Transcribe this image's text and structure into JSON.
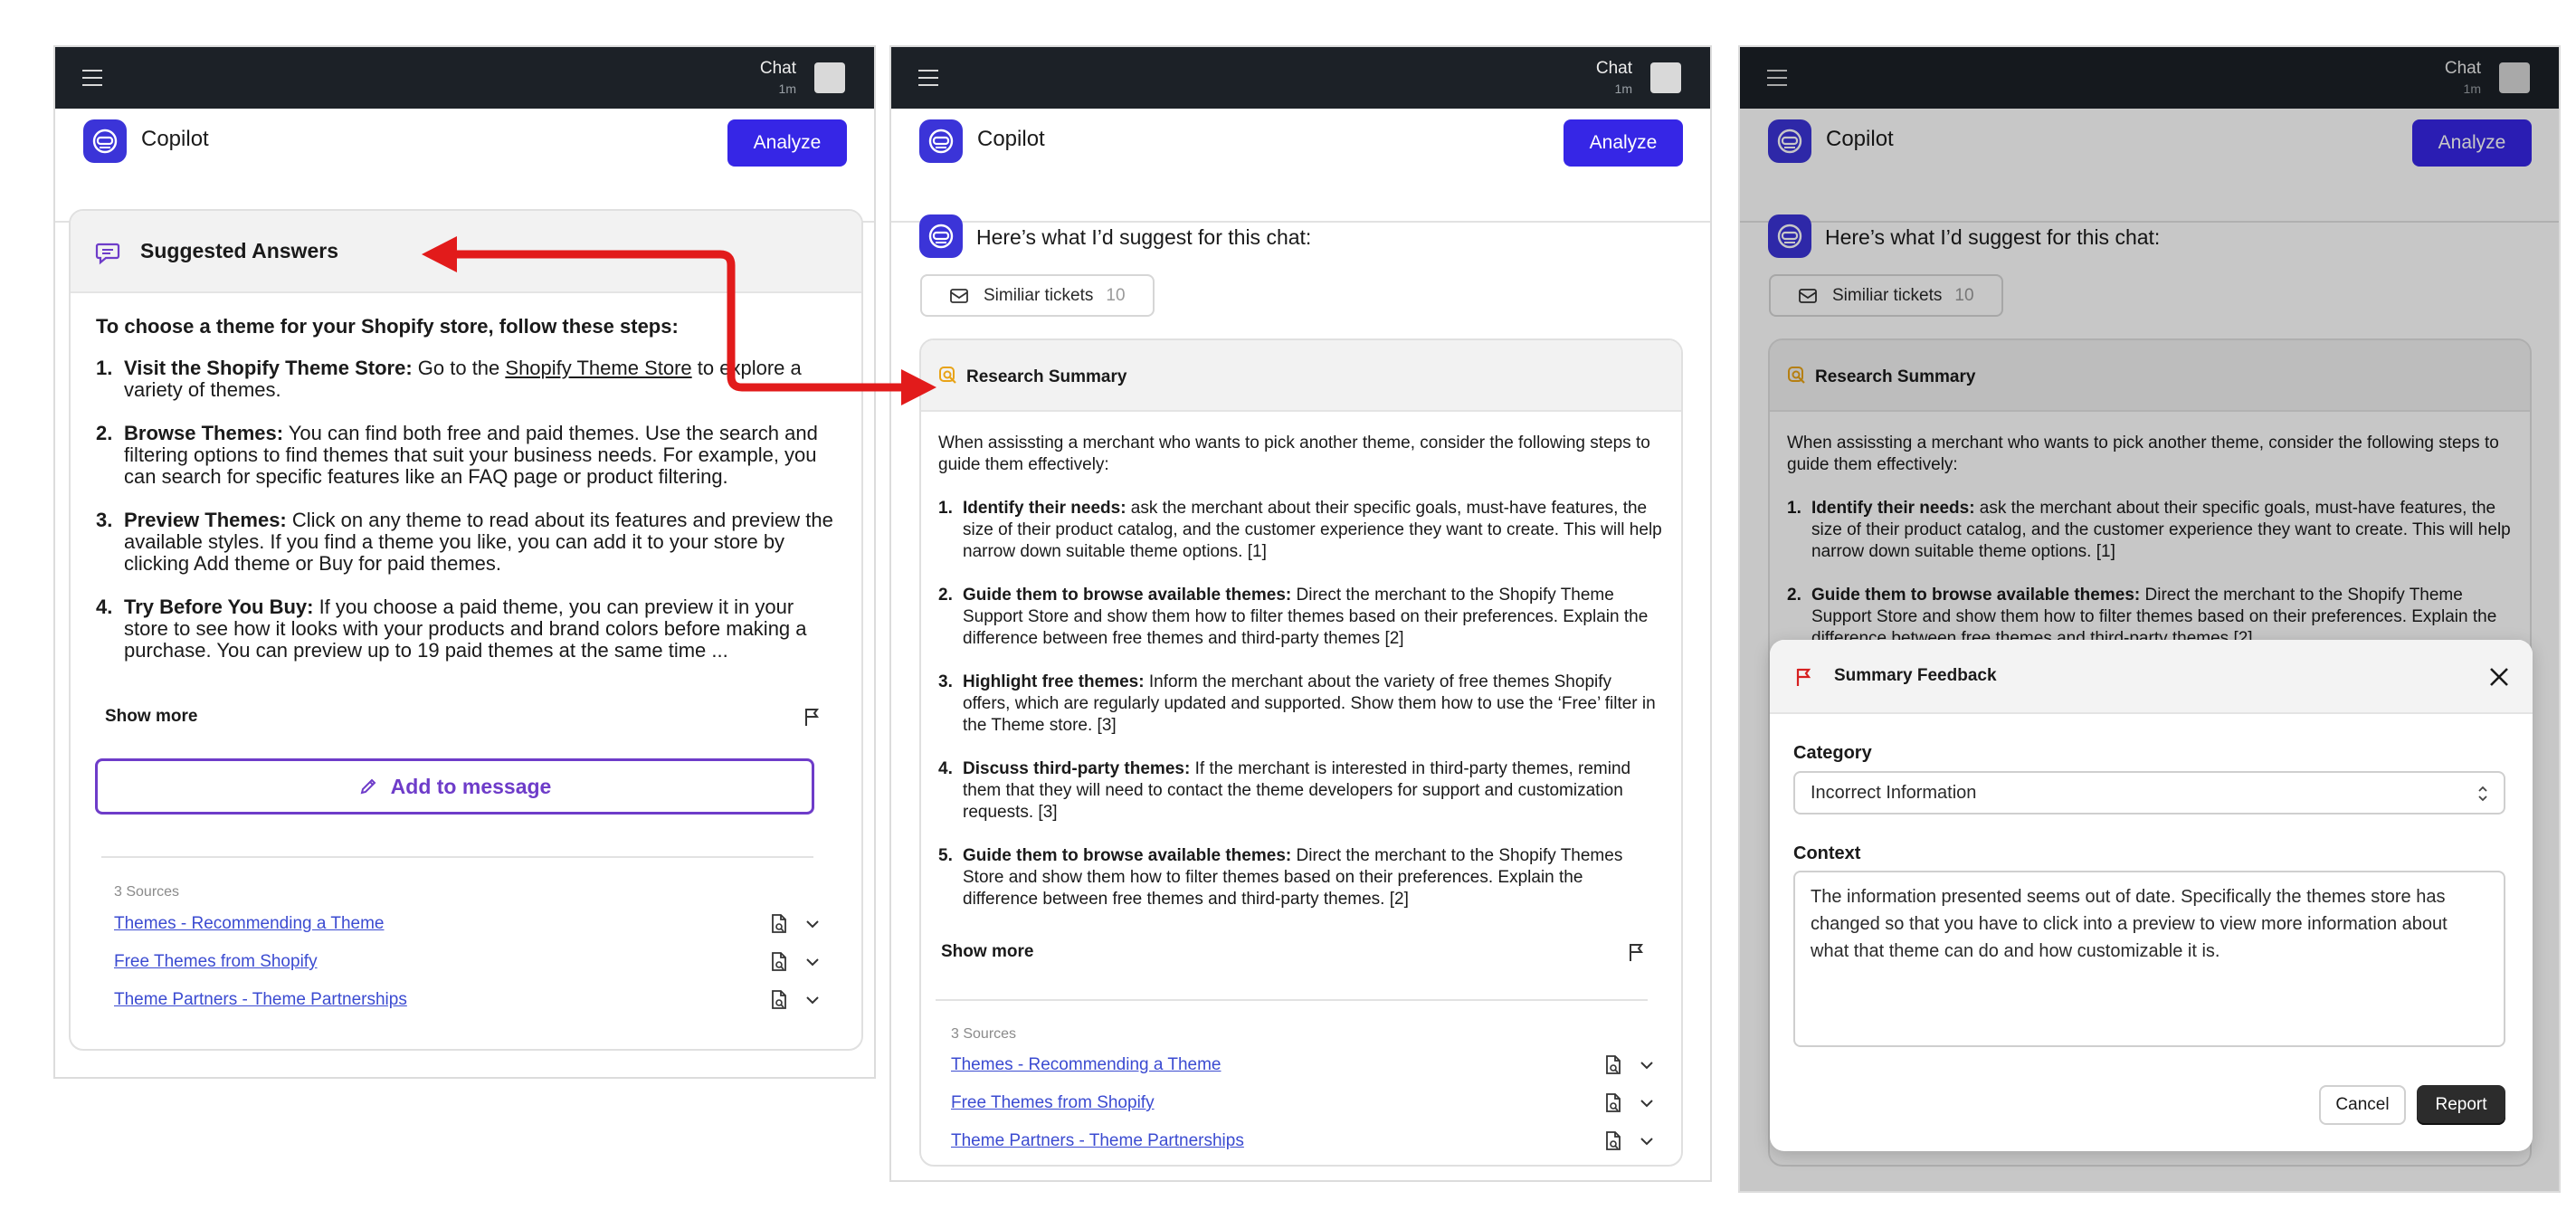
{
  "colors": {
    "topbar": "#1c2127",
    "brand": "#3626e6",
    "purple_accent": "#6e3cc9",
    "link": "#3b4bd1",
    "research_icon": "#e8a317",
    "arrow": "#e21b1b"
  },
  "topbar": {
    "menu_icon": "hamburger-menu-icon",
    "chat_label": "Chat",
    "chat_time": "1m"
  },
  "app": {
    "title": "Copilot",
    "analyze_label": "Analyze"
  },
  "panel1": {
    "card_title": "Suggested Answers",
    "intro": "To choose a theme for your Shopify store, follow these steps:",
    "steps": [
      {
        "num": "1.",
        "title": "Visit the Shopify Theme Store:",
        "before": " Go to the ",
        "link": "Shopify Theme Store",
        "after": " to explore a variety of themes."
      },
      {
        "num": "2.",
        "title": "Browse Themes:",
        "text": " You can find both free and paid themes. Use the search and filtering options to find themes that suit your business needs. For example, you can search for specific features like an FAQ page or product filtering."
      },
      {
        "num": "3.",
        "title": "Preview Themes:",
        "text": " Click on any theme to read about its features and preview the available styles. If you find a theme you like, you can add it to your store by clicking Add theme or Buy for paid themes."
      },
      {
        "num": "4.",
        "title": "Try Before You Buy:",
        "text": " If you choose a paid theme, you can preview it in your store to see how it looks with your products and brand colors before making a purchase. You can preview up to 19 paid themes at the same time ..."
      }
    ],
    "show_more": "Show more",
    "add_to_message": "Add to message",
    "sources_label": "3 Sources",
    "sources": [
      "Themes - Recommending a Theme",
      "Free Themes from Shopify",
      "Theme Partners - Theme Partnerships"
    ]
  },
  "panel2": {
    "suggest_text": "Here’s what I’d suggest for this chat:",
    "similar_label": "Similiar tickets",
    "similar_count": "10",
    "card_title": "Research Summary",
    "intro": "When assissting a merchant who wants to pick another theme, consider the following steps to guide them effectively:",
    "steps": [
      {
        "num": "1.",
        "title": "Identify their needs:",
        "text": " ask the merchant about their specific goals, must-have features, the size of their product catalog, and the customer experience they want to create. This will help narrow down suitable theme options. [1]"
      },
      {
        "num": "2.",
        "title": "Guide them to browse available themes:",
        "text": " Direct the merchant to the Shopify Theme Support Store and show them how to filter themes based on their preferences. Explain the difference between free themes and third-party themes [2]"
      },
      {
        "num": "3.",
        "title": "Highlight free themes:",
        "text": " Inform the merchant about the variety of free themes Shopify offers, which are regularly updated and supported. Show them how to use the ‘Free’ filter in the Theme store. [3]"
      },
      {
        "num": "4.",
        "title": "Discuss third-party themes:",
        "text": " If the merchant is interested in third-party themes, remind them that they will need to contact the theme developers for support and customization requests. [3]"
      },
      {
        "num": "5.",
        "title": "Guide them to browse available themes:",
        "text": " Direct the merchant to the Shopify Themes Store and show them how to filter themes based on their preferences. Explain the difference between free themes and third-party themes. [2]"
      }
    ],
    "show_more": "Show more",
    "sources_label": "3 Sources",
    "sources": [
      "Themes - Recommending a Theme",
      "Free Themes from Shopify",
      "Theme Partners - Theme Partnerships"
    ]
  },
  "modal": {
    "title": "Summary Feedback",
    "category_label": "Category",
    "category_value": "Incorrect Information",
    "context_label": "Context",
    "context_value": "The information presented seems out of date. Specifically the themes store has changed so that you have to click into a preview to view more information about what that theme can do and how customizable it is.",
    "cancel_label": "Cancel",
    "report_label": "Report"
  }
}
